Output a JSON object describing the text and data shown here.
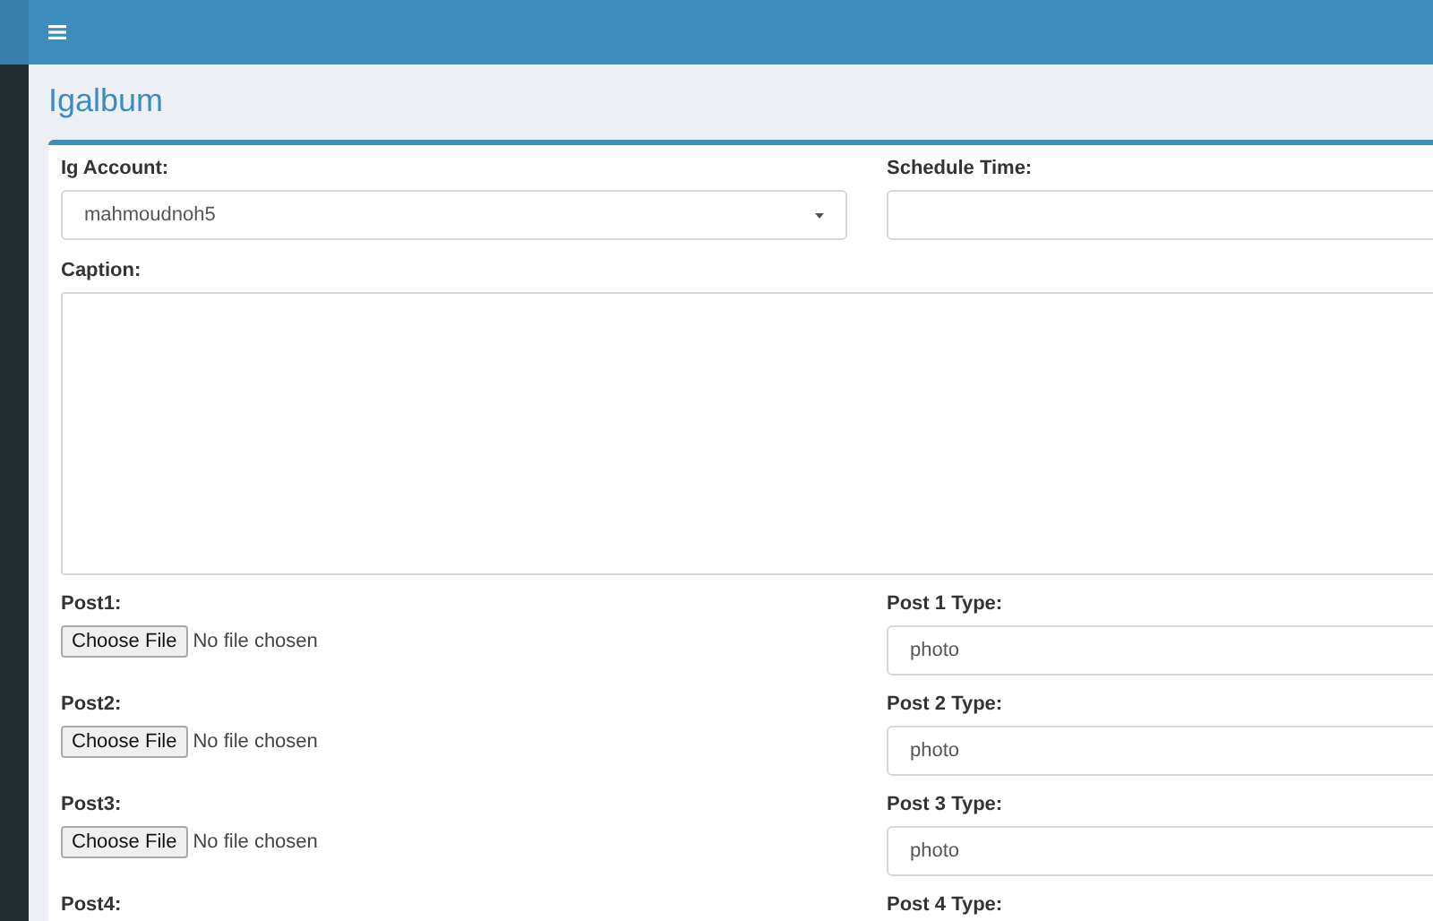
{
  "page_title": "Igalbum",
  "account": {
    "label": "Ig Account:",
    "value": "mahmoudnoh5"
  },
  "schedule": {
    "label": "Schedule Time:"
  },
  "caption": {
    "label": "Caption:"
  },
  "posts": [
    {
      "label": "Post1:",
      "button": "Choose File",
      "status": "No file chosen",
      "type_label": "Post 1 Type:",
      "type_value": "photo"
    },
    {
      "label": "Post2:",
      "button": "Choose File",
      "status": "No file chosen",
      "type_label": "Post 2 Type:",
      "type_value": "photo"
    },
    {
      "label": "Post3:",
      "button": "Choose File",
      "status": "No file chosen",
      "type_label": "Post 3 Type:",
      "type_value": "photo"
    },
    {
      "label": "Post4:",
      "type_label": "Post 4 Type:"
    }
  ]
}
